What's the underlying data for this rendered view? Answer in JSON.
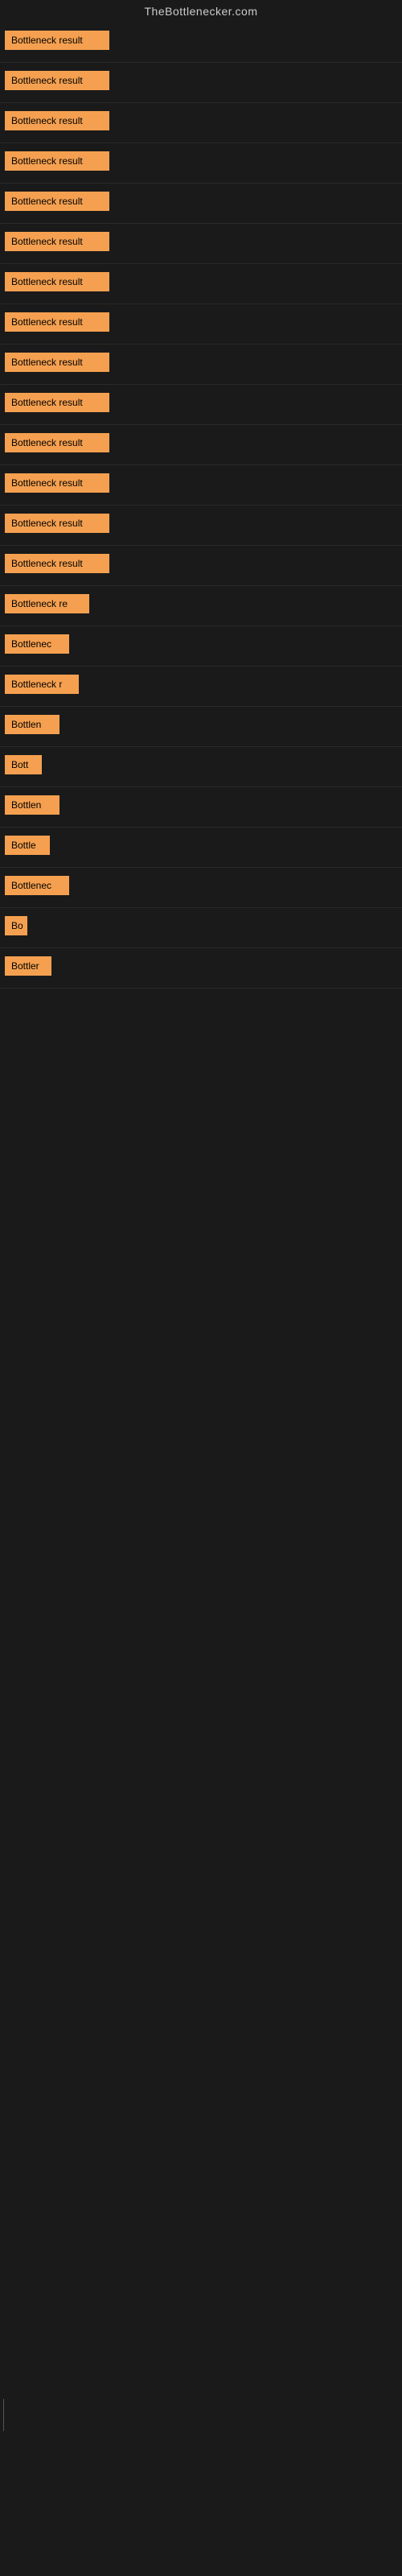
{
  "site": {
    "title": "TheBottlenecker.com"
  },
  "rows": [
    {
      "id": 1,
      "label": "Bottleneck result",
      "width": 130
    },
    {
      "id": 2,
      "label": "Bottleneck result",
      "width": 130
    },
    {
      "id": 3,
      "label": "Bottleneck result",
      "width": 130
    },
    {
      "id": 4,
      "label": "Bottleneck result",
      "width": 130
    },
    {
      "id": 5,
      "label": "Bottleneck result",
      "width": 130
    },
    {
      "id": 6,
      "label": "Bottleneck result",
      "width": 130
    },
    {
      "id": 7,
      "label": "Bottleneck result",
      "width": 130
    },
    {
      "id": 8,
      "label": "Bottleneck result",
      "width": 130
    },
    {
      "id": 9,
      "label": "Bottleneck result",
      "width": 130
    },
    {
      "id": 10,
      "label": "Bottleneck result",
      "width": 130
    },
    {
      "id": 11,
      "label": "Bottleneck result",
      "width": 130
    },
    {
      "id": 12,
      "label": "Bottleneck result",
      "width": 130
    },
    {
      "id": 13,
      "label": "Bottleneck result",
      "width": 130
    },
    {
      "id": 14,
      "label": "Bottleneck result",
      "width": 130
    },
    {
      "id": 15,
      "label": "Bottleneck re",
      "width": 105
    },
    {
      "id": 16,
      "label": "Bottlenec",
      "width": 80
    },
    {
      "id": 17,
      "label": "Bottleneck r",
      "width": 92
    },
    {
      "id": 18,
      "label": "Bottlen",
      "width": 68
    },
    {
      "id": 19,
      "label": "Bott",
      "width": 46
    },
    {
      "id": 20,
      "label": "Bottlen",
      "width": 68
    },
    {
      "id": 21,
      "label": "Bottle",
      "width": 56
    },
    {
      "id": 22,
      "label": "Bottlenec",
      "width": 80
    },
    {
      "id": 23,
      "label": "Bo",
      "width": 28
    },
    {
      "id": 24,
      "label": "Bottler",
      "width": 58
    }
  ],
  "colors": {
    "bar_bg": "#f5a050",
    "bar_text": "#000000",
    "page_bg": "#1a1a1a",
    "site_title": "#cccccc"
  }
}
